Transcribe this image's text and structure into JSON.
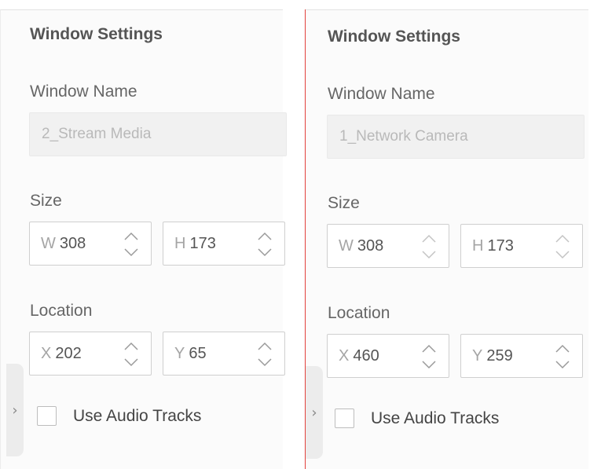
{
  "panels": [
    {
      "heading": "Window Settings",
      "window_name_label": "Window Name",
      "window_name_value": "2_Stream Media",
      "size_label": "Size",
      "w_prefix": "W",
      "w_value": "308",
      "h_prefix": "H",
      "h_value": "173",
      "location_label": "Location",
      "x_prefix": "X",
      "x_value": "202",
      "y_prefix": "Y",
      "y_value": "65",
      "audio_label": "Use Audio Tracks",
      "audio_checked": false
    },
    {
      "heading": "Window Settings",
      "window_name_label": "Window Name",
      "window_name_value": "1_Network Camera",
      "size_label": "Size",
      "w_prefix": "W",
      "w_value": "308",
      "h_prefix": "H",
      "h_value": "173",
      "location_label": "Location",
      "x_prefix": "X",
      "x_value": "460",
      "y_prefix": "Y",
      "y_value": "259",
      "audio_label": "Use Audio Tracks",
      "audio_checked": false
    }
  ],
  "icons": {
    "expand": "chevron-right-icon",
    "stepper": "stepper-up-down-icon"
  },
  "colors": {
    "divider": "#e2413b",
    "panel_bg": "#fbfbfb",
    "field_disabled_bg": "#f1f1f1"
  }
}
